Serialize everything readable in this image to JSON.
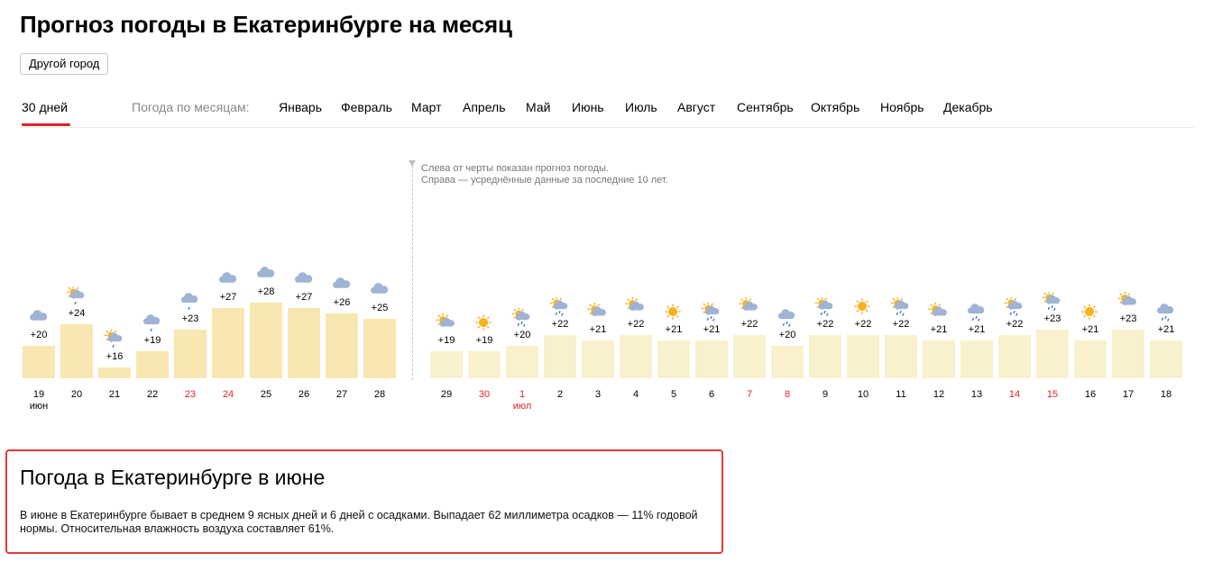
{
  "page": {
    "title": "Прогноз погоды в Екатеринбурге на месяц",
    "city_button": "Другой город"
  },
  "tabs": {
    "active": "30 дней",
    "months_label": "Погода по месяцам:",
    "months": [
      "Январь",
      "Февраль",
      "Март",
      "Апрель",
      "Май",
      "Июнь",
      "Июль",
      "Август",
      "Сентябрь",
      "Октябрь",
      "Ноябрь",
      "Декабрь"
    ]
  },
  "forecast_note": {
    "line1": "Слева от черты показан прогноз погоды.",
    "line2": "Справа — усреднённые данные за последние 10 лет."
  },
  "colors": {
    "red": "#e0232a",
    "bar_forecast": "#f9e7b1",
    "bar_average": "#f9f1cd"
  },
  "days": [
    {
      "day": "19",
      "month": "июн",
      "temp": "+20",
      "icon": "cloud-icon",
      "red": false,
      "section": "forecast"
    },
    {
      "day": "20",
      "temp": "+24",
      "icon": "sun-cloud-light-rain-icon",
      "red": false,
      "section": "forecast"
    },
    {
      "day": "21",
      "temp": "+16",
      "icon": "sun-cloud-light-rain-icon",
      "red": false,
      "section": "forecast"
    },
    {
      "day": "22",
      "temp": "+19",
      "icon": "cloud-light-rain-icon",
      "red": false,
      "section": "forecast"
    },
    {
      "day": "23",
      "temp": "+23",
      "icon": "cloud-light-rain-icon",
      "red": true,
      "section": "forecast"
    },
    {
      "day": "24",
      "temp": "+27",
      "icon": "cloud-icon",
      "red": true,
      "section": "forecast"
    },
    {
      "day": "25",
      "temp": "+28",
      "icon": "cloud-icon",
      "red": false,
      "section": "forecast"
    },
    {
      "day": "26",
      "temp": "+27",
      "icon": "cloud-icon",
      "red": false,
      "section": "forecast"
    },
    {
      "day": "27",
      "temp": "+26",
      "icon": "cloud-icon",
      "red": false,
      "section": "forecast"
    },
    {
      "day": "28",
      "temp": "+25",
      "icon": "cloud-icon",
      "red": false,
      "section": "forecast"
    },
    {
      "day": "29",
      "temp": "+19",
      "icon": "sun-cloud-icon",
      "red": false,
      "section": "average"
    },
    {
      "day": "30",
      "temp": "+19",
      "icon": "sun-icon",
      "red": true,
      "section": "average"
    },
    {
      "day": "1",
      "month": "июл",
      "temp": "+20",
      "icon": "sun-cloud-rain-icon",
      "red": true,
      "section": "average"
    },
    {
      "day": "2",
      "temp": "+22",
      "icon": "sun-cloud-rain-icon",
      "red": false,
      "section": "average"
    },
    {
      "day": "3",
      "temp": "+21",
      "icon": "sun-cloud-icon",
      "red": false,
      "section": "average"
    },
    {
      "day": "4",
      "temp": "+22",
      "icon": "sun-cloud-icon",
      "red": false,
      "section": "average"
    },
    {
      "day": "5",
      "temp": "+21",
      "icon": "sun-icon",
      "red": false,
      "section": "average"
    },
    {
      "day": "6",
      "temp": "+21",
      "icon": "sun-cloud-rain-icon",
      "red": false,
      "section": "average"
    },
    {
      "day": "7",
      "temp": "+22",
      "icon": "sun-cloud-icon",
      "red": true,
      "section": "average"
    },
    {
      "day": "8",
      "temp": "+20",
      "icon": "cloud-rain-icon",
      "red": true,
      "section": "average"
    },
    {
      "day": "9",
      "temp": "+22",
      "icon": "sun-cloud-rain-icon",
      "red": false,
      "section": "average"
    },
    {
      "day": "10",
      "temp": "+22",
      "icon": "sun-icon",
      "red": false,
      "section": "average"
    },
    {
      "day": "11",
      "temp": "+22",
      "icon": "sun-cloud-rain-icon",
      "red": false,
      "section": "average"
    },
    {
      "day": "12",
      "temp": "+21",
      "icon": "sun-cloud-icon",
      "red": false,
      "section": "average"
    },
    {
      "day": "13",
      "temp": "+21",
      "icon": "cloud-rain-icon",
      "red": false,
      "section": "average"
    },
    {
      "day": "14",
      "temp": "+22",
      "icon": "sun-cloud-rain-icon",
      "red": true,
      "section": "average"
    },
    {
      "day": "15",
      "temp": "+23",
      "icon": "sun-cloud-rain-icon",
      "red": true,
      "section": "average"
    },
    {
      "day": "16",
      "temp": "+21",
      "icon": "sun-icon",
      "red": false,
      "section": "average"
    },
    {
      "day": "17",
      "temp": "+23",
      "icon": "sun-cloud-icon",
      "red": false,
      "section": "average"
    },
    {
      "day": "18",
      "temp": "+21",
      "icon": "cloud-rain-icon",
      "red": false,
      "section": "average"
    }
  ],
  "summary": {
    "title": "Погода в Екатеринбурге в июне",
    "text": "В июне в Екатеринбурге бывает в среднем 9 ясных дней и 6 дней с осадками. Выпадает 62 миллиметра осадков — 11% годовой нормы. Относительная влажность воздуха составляет 61%."
  }
}
